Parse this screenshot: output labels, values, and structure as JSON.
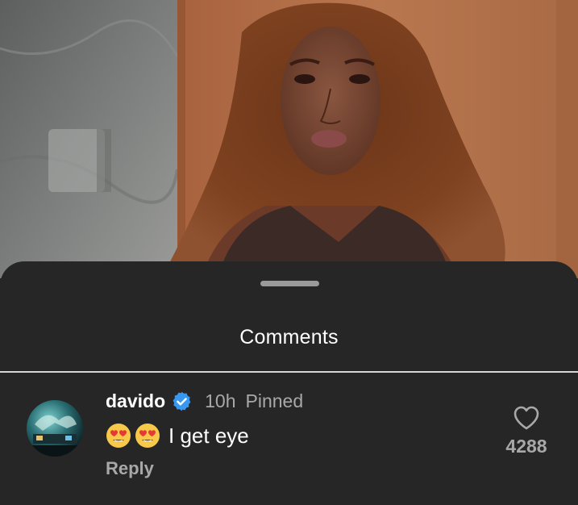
{
  "sheet": {
    "title": "Comments"
  },
  "comment": {
    "username": "davido",
    "verified": true,
    "time": "10h",
    "pinned_label": "Pinned",
    "emojis": [
      "heart-eyes-emoji",
      "heart-eyes-emoji"
    ],
    "text": "I get eye",
    "reply_label": "Reply",
    "like_count": "4288"
  },
  "colors": {
    "sheet_background": "#262626",
    "verified_badge": "#3897f0",
    "secondary_text": "#a8a8a8",
    "primary_text": "#ffffff"
  },
  "icons": {
    "verified": "verified-badge-icon",
    "like": "heart-outline-icon",
    "drag": "drag-handle"
  }
}
